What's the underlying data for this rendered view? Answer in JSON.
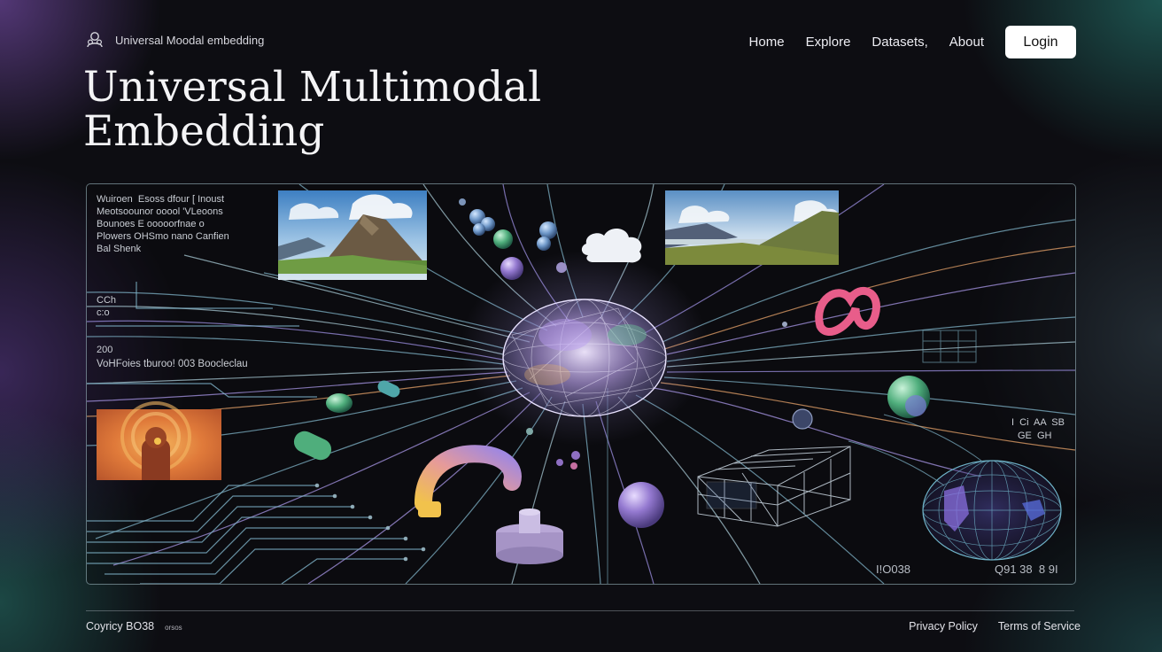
{
  "header": {
    "brand": "Universal Moodal embedding",
    "nav": [
      "Home",
      "Explore",
      "Datasets,",
      "About"
    ],
    "login": "Login"
  },
  "hero_title": [
    "Universal Multimodal",
    "Embedding"
  ],
  "visual": {
    "text_block": "Wuiroen  Esoss dfour [ Inoust\nMeotsoounor ooool 'VLeoons\nBounoes E ooooorfnae o\nPlowers OHSmo nano Canfien\nBal Shenk",
    "label_a": "CCh\nc:o",
    "label_b": "200",
    "label_c": "VoHFoies tburoo! 003 Boocleclau",
    "label_d": "I  Ci  AA  SB",
    "label_e": "GE  GH",
    "label_f": "I!O038",
    "label_g": "Q91 38  8 9I"
  },
  "footer": {
    "copyright": "Coyricy BO38",
    "copyright_small": "orsos",
    "links": [
      "Privacy Policy",
      "Terms of Service"
    ]
  }
}
